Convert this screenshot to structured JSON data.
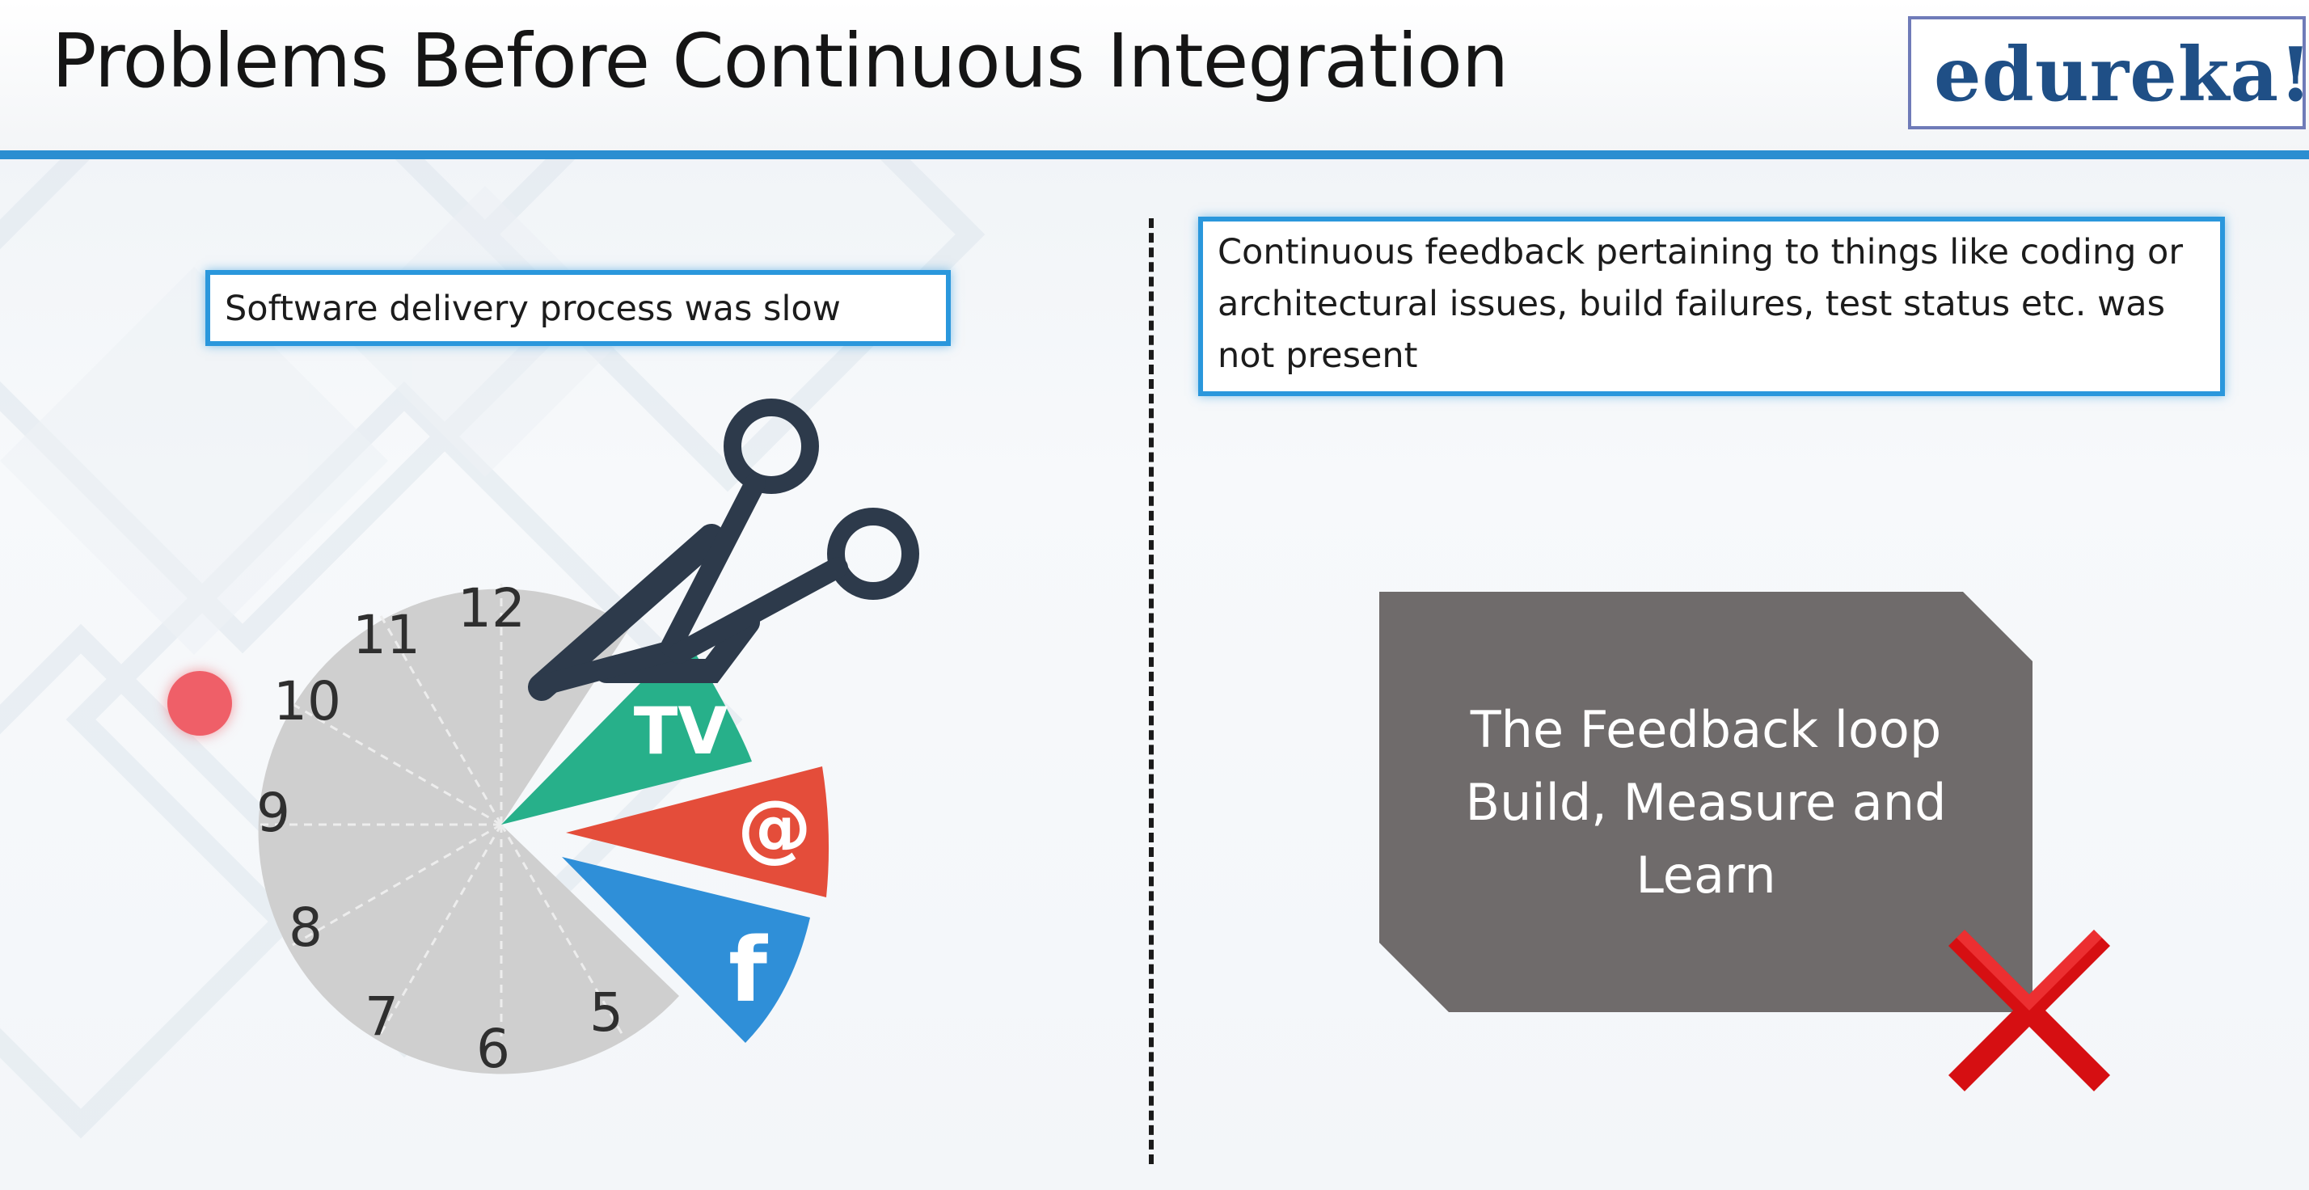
{
  "slide": {
    "title": "Problems Before Continuous Integration",
    "logo_text": "edureka!",
    "accent_color": "#2b8ed1"
  },
  "left_panel": {
    "callout_text": "Software delivery process was slow",
    "clock_numbers": [
      "12",
      "11",
      "10",
      "9",
      "8",
      "7",
      "6",
      "5"
    ],
    "slices": [
      {
        "label": "TV",
        "color": "#27b08a"
      },
      {
        "label": "@",
        "color": "#e44d3a"
      },
      {
        "label": "f",
        "color": "#2f8fd8"
      }
    ],
    "icons": [
      "scissors-icon",
      "clock-icon",
      "pointer-dot"
    ]
  },
  "right_panel": {
    "callout_text": "Continuous feedback pertaining to things like coding or architectural issues, build failures, test status etc. was not present",
    "feedback_lines": [
      "The Feedback loop",
      "Build, Measure and",
      "Learn"
    ],
    "feedback_color": "#6f6b6b",
    "cross_icon": "red-x-icon",
    "cross_color": "#d60f12"
  }
}
